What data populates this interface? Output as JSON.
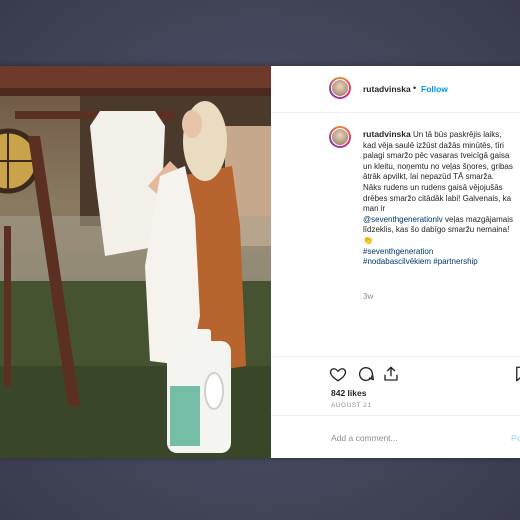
{
  "post": {
    "username": "rutadvinska",
    "separator": "•",
    "follow_label": "Follow",
    "caption_user": "rutadvinska",
    "caption_text_1": "Un tā būs paskrējis laiks, kad vēja saulē izžūst dažās minūtēs, tīri palagi smaržo pēc vasaras tveicīgā gaisa un kleitu, noņemtu no veļas šņores, gribas ātrāk apvilkt, lai nepazūd TĀ smarža. Nāks rudens un rudens gaisā vējojušās drēbes smaržo citādāk labi! Galvenais, ka man ir",
    "mention": "@seventhgenerationlv",
    "caption_text_2": "veļas mazgājamais līdzeklis, kas šo dabīgo smaržu nemaina! 👏",
    "hashtag_1": "#seventhgeneration",
    "hashtag_2": "#nodabascilvēkiem",
    "hashtag_3": "#partnership",
    "time_ago": "3w",
    "likes": "842 likes",
    "date": "AUGUST 21",
    "comment_placeholder": "Add a comment...",
    "post_label": "Po"
  },
  "icons": [
    "heart-icon",
    "comment-icon",
    "share-icon",
    "bookmark-icon"
  ],
  "colors": {
    "link": "#00376b",
    "follow": "#0095f6",
    "background": "#45485c"
  }
}
